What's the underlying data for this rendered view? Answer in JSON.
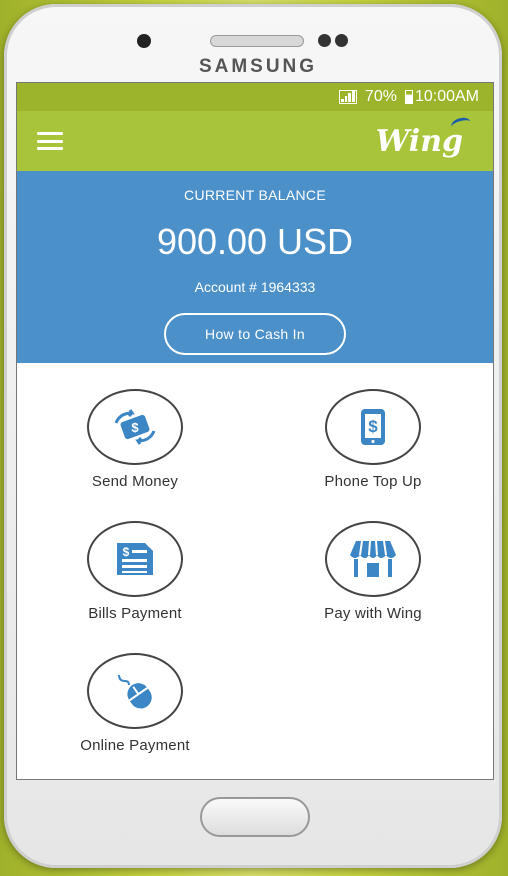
{
  "device": {
    "brand": "SAMSUNG"
  },
  "statusbar": {
    "battery": "70%",
    "time": "10:00AM"
  },
  "appbar": {
    "logo": "Wing",
    "menu_icon": "hamburger-icon"
  },
  "balance": {
    "label": "CURRENT BALANCE",
    "amount": "900.00 USD",
    "account": "Account # 1964333",
    "button": "How to Cash In"
  },
  "actions": [
    {
      "label": "Send Money",
      "icon": "money-transfer-icon"
    },
    {
      "label": "Phone Top Up",
      "icon": "phone-dollar-icon"
    },
    {
      "label": "Bills Payment",
      "icon": "bill-document-icon"
    },
    {
      "label": "Pay with Wing",
      "icon": "storefront-icon"
    },
    {
      "label": "Online Payment",
      "icon": "mouse-icon"
    }
  ],
  "colors": {
    "accent_green": "#a8c43b",
    "balance_blue": "#4b90c9",
    "icon_blue": "#3c86c6"
  }
}
